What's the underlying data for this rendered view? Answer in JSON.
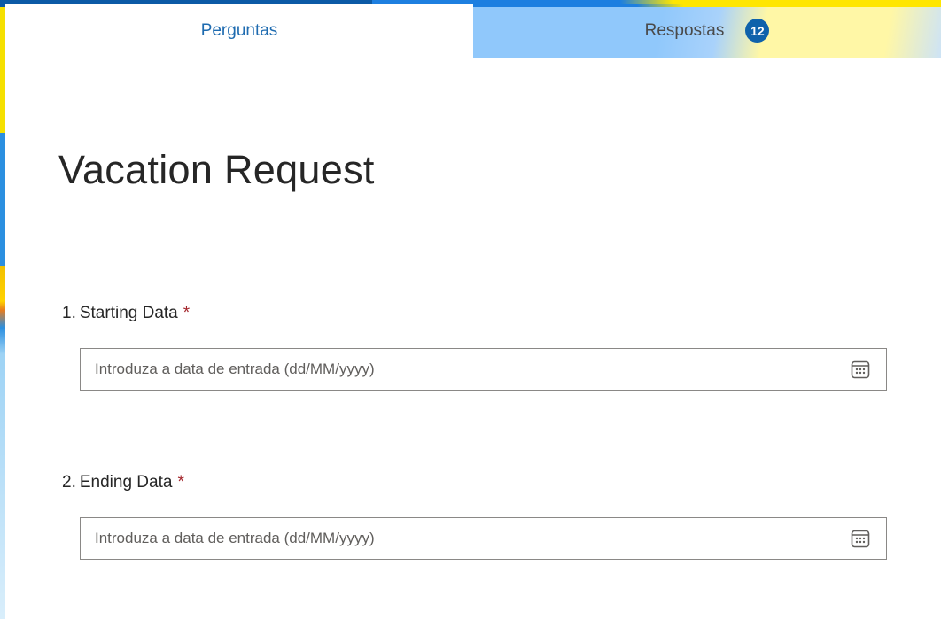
{
  "tabs": {
    "questions_label": "Perguntas",
    "responses_label": "Respostas",
    "responses_count": "12"
  },
  "form": {
    "title": "Vacation Request",
    "questions": [
      {
        "number": "1.",
        "label": "Starting Data",
        "required_mark": "*",
        "placeholder": "Introduza a data de entrada (dd/MM/yyyy)",
        "value": "",
        "icon": "calendar-icon"
      },
      {
        "number": "2.",
        "label": "Ending Data",
        "required_mark": "*",
        "placeholder": "Introduza a data de entrada (dd/MM/yyyy)",
        "value": "",
        "icon": "calendar-icon"
      }
    ]
  },
  "colors": {
    "tab_active_text": "#1e6bb0",
    "badge_bg": "#0f62ab",
    "required": "#a4262c",
    "title_text": "#262626"
  }
}
